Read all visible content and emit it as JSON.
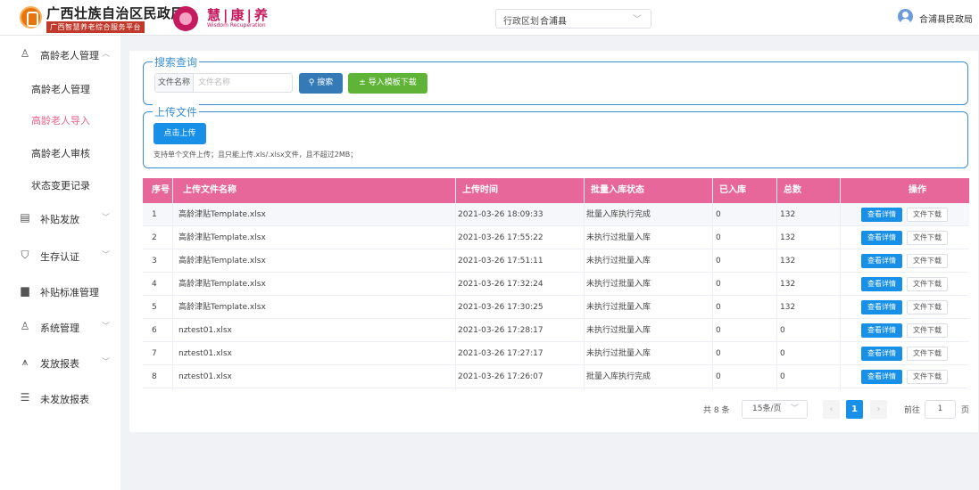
{
  "header": {
    "brand_title": "广西壮族自治区民政厅",
    "brand_subtitle": "广西智慧养老综合服务平台",
    "brand2_title": "慧|康|养",
    "brand2_subtitle": "Wisdom Recuperation",
    "region_label": "行政区划",
    "region_value": "合浦县",
    "user_name": "合浦县民政局"
  },
  "sidebar": {
    "groups": [
      {
        "label": "高龄老人管理",
        "icon": "elderly-icon",
        "expanded": true
      },
      {
        "label": "补贴发放",
        "icon": "ledger-icon"
      },
      {
        "label": "生存认证",
        "icon": "shield-icon"
      },
      {
        "label": "补贴标准管理",
        "icon": "book-icon"
      },
      {
        "label": "系统管理",
        "icon": "users-icon"
      },
      {
        "label": "发放报表",
        "icon": "chart-icon"
      },
      {
        "label": "未发放报表",
        "icon": "report-icon"
      }
    ],
    "sub_items": [
      {
        "label": "高龄老人管理"
      },
      {
        "label": "高龄老人导入",
        "active": true
      },
      {
        "label": "高龄老人审核"
      },
      {
        "label": "状态变更记录"
      }
    ]
  },
  "search": {
    "legend": "搜索查询",
    "field_label": "文件名称",
    "placeholder": "文件名称",
    "search_button": "搜索",
    "import_button": "导入模板下载"
  },
  "upload": {
    "legend": "上传文件",
    "button": "点击上传",
    "hint": "支持单个文件上传；且只能上传.xls/.xlsx文件，且不超过2MB；"
  },
  "table": {
    "columns": [
      "序号",
      "上传文件名称",
      "上传时间",
      "批量入库状态",
      "已入库",
      "总数",
      "操作"
    ],
    "rows": [
      {
        "no": "1",
        "name": "高龄津贴Template.xlsx",
        "time": "2021-03-26 18:09:33",
        "status": "批量入库执行完成",
        "stored": "0",
        "total": "132"
      },
      {
        "no": "2",
        "name": "高龄津贴Template.xlsx",
        "time": "2021-03-26 17:55:22",
        "status": "未执行过批量入库",
        "stored": "0",
        "total": "132"
      },
      {
        "no": "3",
        "name": "高龄津贴Template.xlsx",
        "time": "2021-03-26 17:51:11",
        "status": "未执行过批量入库",
        "stored": "0",
        "total": "132"
      },
      {
        "no": "4",
        "name": "高龄津贴Template.xlsx",
        "time": "2021-03-26 17:32:24",
        "status": "未执行过批量入库",
        "stored": "0",
        "total": "132"
      },
      {
        "no": "5",
        "name": "高龄津贴Template.xlsx",
        "time": "2021-03-26 17:30:25",
        "status": "未执行过批量入库",
        "stored": "0",
        "total": "132"
      },
      {
        "no": "6",
        "name": "nztest01.xlsx",
        "time": "2021-03-26 17:28:17",
        "status": "未执行过批量入库",
        "stored": "0",
        "total": "0"
      },
      {
        "no": "7",
        "name": "nztest01.xlsx",
        "time": "2021-03-26 17:27:17",
        "status": "未执行过批量入库",
        "stored": "0",
        "total": "0"
      },
      {
        "no": "8",
        "name": "nztest01.xlsx",
        "time": "2021-03-26 17:26:07",
        "status": "批量入库执行完成",
        "stored": "0",
        "total": "0"
      }
    ],
    "view_button": "查看详情",
    "download_button": "文件下载"
  },
  "pagination": {
    "total_text": "共 8 条",
    "page_size": "15条/页",
    "current_page": "1",
    "goto_label": "前往",
    "goto_value": "1",
    "goto_unit": "页"
  },
  "colors": {
    "accent": "#e8679a",
    "primary": "#1890e8",
    "active_menu": "#e8658b",
    "fieldset_border": "#3b8fd0",
    "import_green": "#5fb336"
  }
}
